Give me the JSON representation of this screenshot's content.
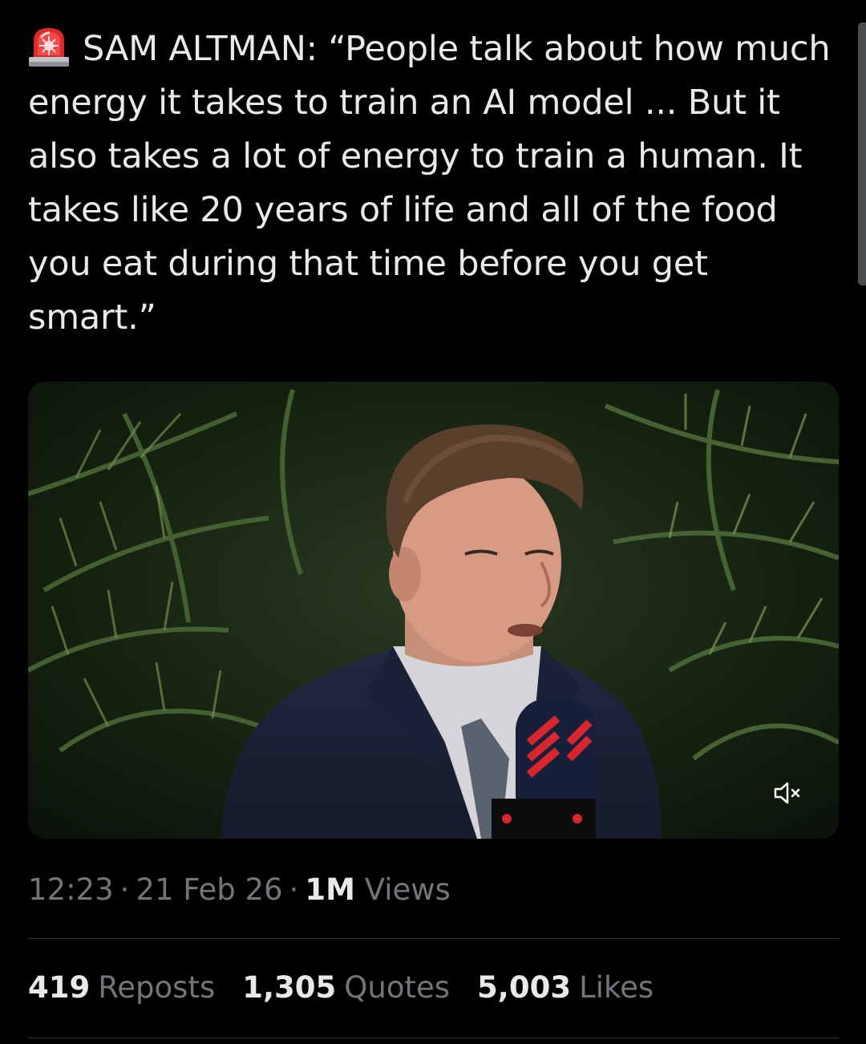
{
  "tweet": {
    "emoji_icon": "police-siren-icon",
    "text": "SAM ALTMAN: “People talk about how much energy it takes to train an AI model ... But it also takes a lot of energy to train a human. It takes like 20 years of life and all of the food you eat during that time before you get smart.”"
  },
  "media": {
    "type": "video",
    "mute_icon": "muted-speaker-icon"
  },
  "meta": {
    "time": "12:23",
    "separator": "·",
    "date": "21 Feb 26",
    "views_count": "1M",
    "views_label": "Views"
  },
  "stats": {
    "reposts_count": "419",
    "reposts_label": "Reposts",
    "quotes_count": "1,305",
    "quotes_label": "Quotes",
    "likes_count": "5,003",
    "likes_label": "Likes"
  },
  "colors": {
    "background": "#000000",
    "text_primary": "#e7e9ea",
    "text_secondary": "#71767b",
    "divider": "#2f3336"
  }
}
